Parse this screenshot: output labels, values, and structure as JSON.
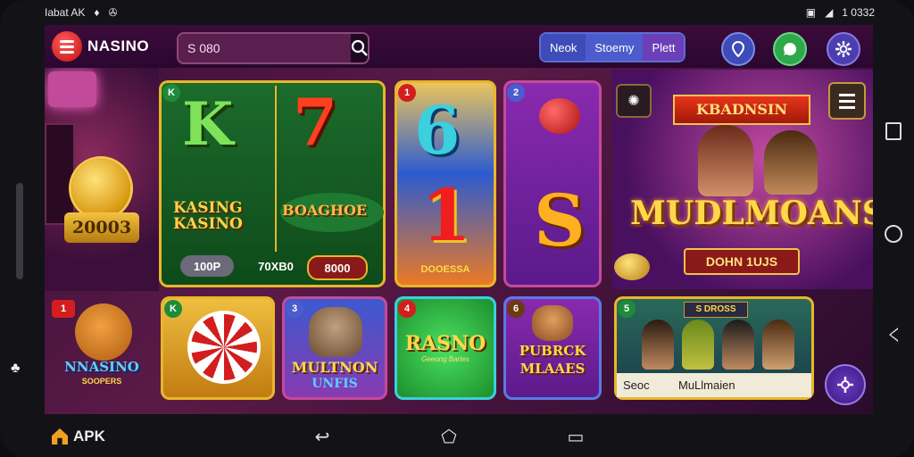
{
  "status": {
    "left_text": "Iabat AK",
    "right_text": "1 0332"
  },
  "header": {
    "brand": "NASINO",
    "search_value": "S 080",
    "seg_tabs": [
      "Neok",
      "Stoemy",
      "Plett"
    ]
  },
  "left_panel": {
    "coin_value": "20003"
  },
  "featured": {
    "reel1_symbol": "K",
    "reel2_symbol": "7",
    "reel1_text": "KASING KASINO",
    "reel2_text": "BOAGHOE",
    "pill_left": "100P",
    "pill_mid": "70XB0",
    "pill_right": "8000",
    "corner_badge": "K"
  },
  "tile_6": {
    "badge": "1",
    "top_symbol": "6",
    "bottom_symbol": "1",
    "footer": "DOOESSA"
  },
  "tile_s": {
    "badge": "2",
    "symbol": "S"
  },
  "promo": {
    "ribbon": "KBADNSIN",
    "title": "MUDLMOANS",
    "subtitle": "DOHN 1UJS"
  },
  "bottom_tiles": [
    {
      "badge": "1",
      "label": "NNASINO",
      "sub": "SOOPERS"
    },
    {
      "badge": "K",
      "label": ""
    },
    {
      "badge": "3",
      "label": "MULTNON",
      "sub": "UNFIS"
    },
    {
      "badge": "4",
      "label": "RASNO",
      "sub": "Geeong Bartes"
    },
    {
      "badge": "6",
      "label": "PUBRCK",
      "sub": "MLAAES"
    },
    {
      "badge": "5",
      "ribbon": "S DROSS",
      "footer_left": "Seoc",
      "footer_right": "MuLlmaien"
    }
  ],
  "bottom_nav": {
    "apk_label": "APK"
  },
  "colors": {
    "accent_gold": "#e8b62a",
    "bg_purple": "#3b0f3a",
    "brand_red": "#c21010"
  }
}
